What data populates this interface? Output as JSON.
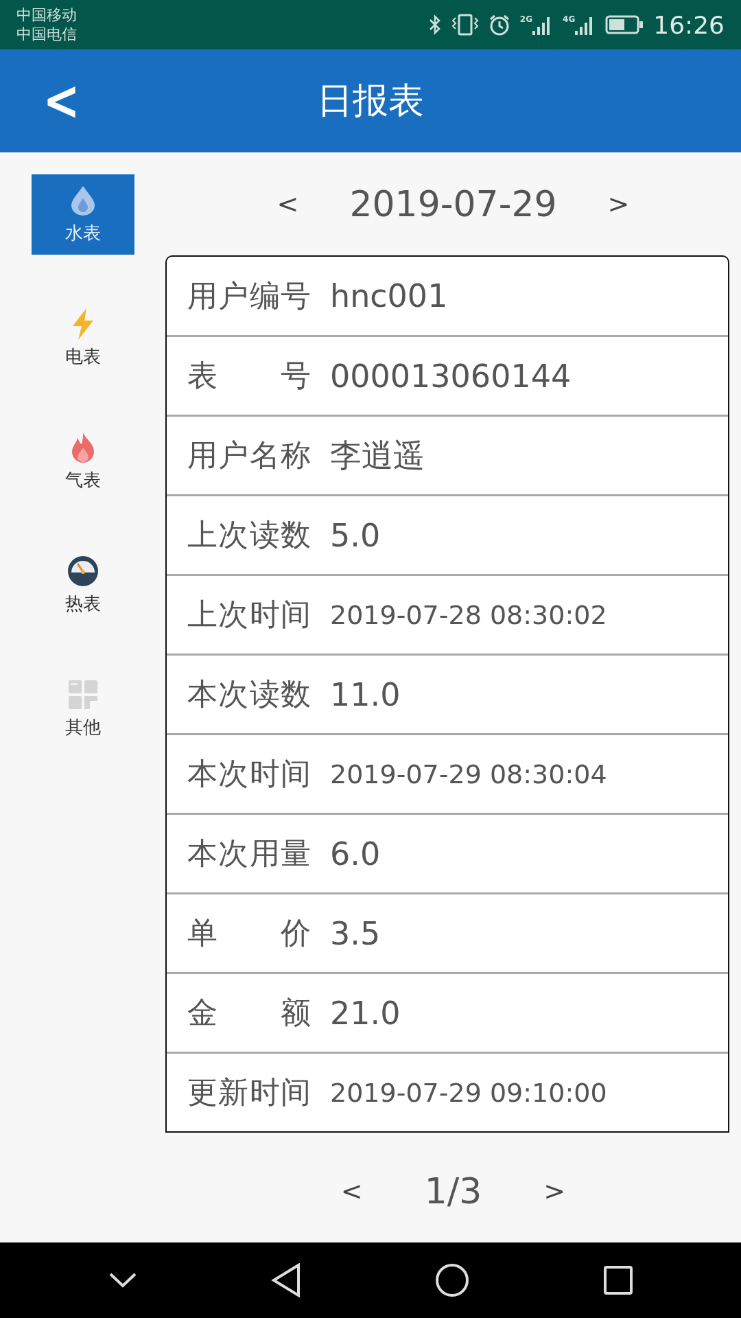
{
  "status_bar": {
    "carriers": [
      "中国移动",
      "中国电信"
    ],
    "network_labels": [
      "2G",
      "4G"
    ],
    "time": "16:26"
  },
  "header": {
    "back": "<",
    "title": "日报表"
  },
  "sidebar": {
    "items": [
      {
        "label": "水表",
        "kind": "water",
        "selected": true
      },
      {
        "label": "电表",
        "kind": "electric",
        "selected": false
      },
      {
        "label": "气表",
        "kind": "gas",
        "selected": false
      },
      {
        "label": "热表",
        "kind": "heat",
        "selected": false
      },
      {
        "label": "其他",
        "kind": "other",
        "selected": false
      }
    ]
  },
  "date_nav": {
    "prev": "<",
    "date": "2019-07-29",
    "next": ">"
  },
  "records": [
    {
      "label": "用户编号",
      "value": "hnc001",
      "kind": "plain"
    },
    {
      "label": "表号",
      "value": "000013060144",
      "kind": "plain"
    },
    {
      "label": "用户名称",
      "value": "李逍遥",
      "kind": "plain"
    },
    {
      "label": "上次读数",
      "value": "5.0",
      "kind": "plain"
    },
    {
      "label": "上次时间",
      "value": "2019-07-28 08:30:02",
      "kind": "datetime"
    },
    {
      "label": "本次读数",
      "value": "11.0",
      "kind": "plain"
    },
    {
      "label": "本次时间",
      "value": "2019-07-29 08:30:04",
      "kind": "datetime"
    },
    {
      "label": "本次用量",
      "value": "6.0",
      "kind": "plain"
    },
    {
      "label": "单价",
      "value": "3.5",
      "kind": "plain"
    },
    {
      "label": "金额",
      "value": "21.0",
      "kind": "plain"
    },
    {
      "label": "更新时间",
      "value": "2019-07-29 09:10:00",
      "kind": "datetime"
    }
  ],
  "pager": {
    "prev": "<",
    "page": "1/3",
    "next": ">"
  }
}
